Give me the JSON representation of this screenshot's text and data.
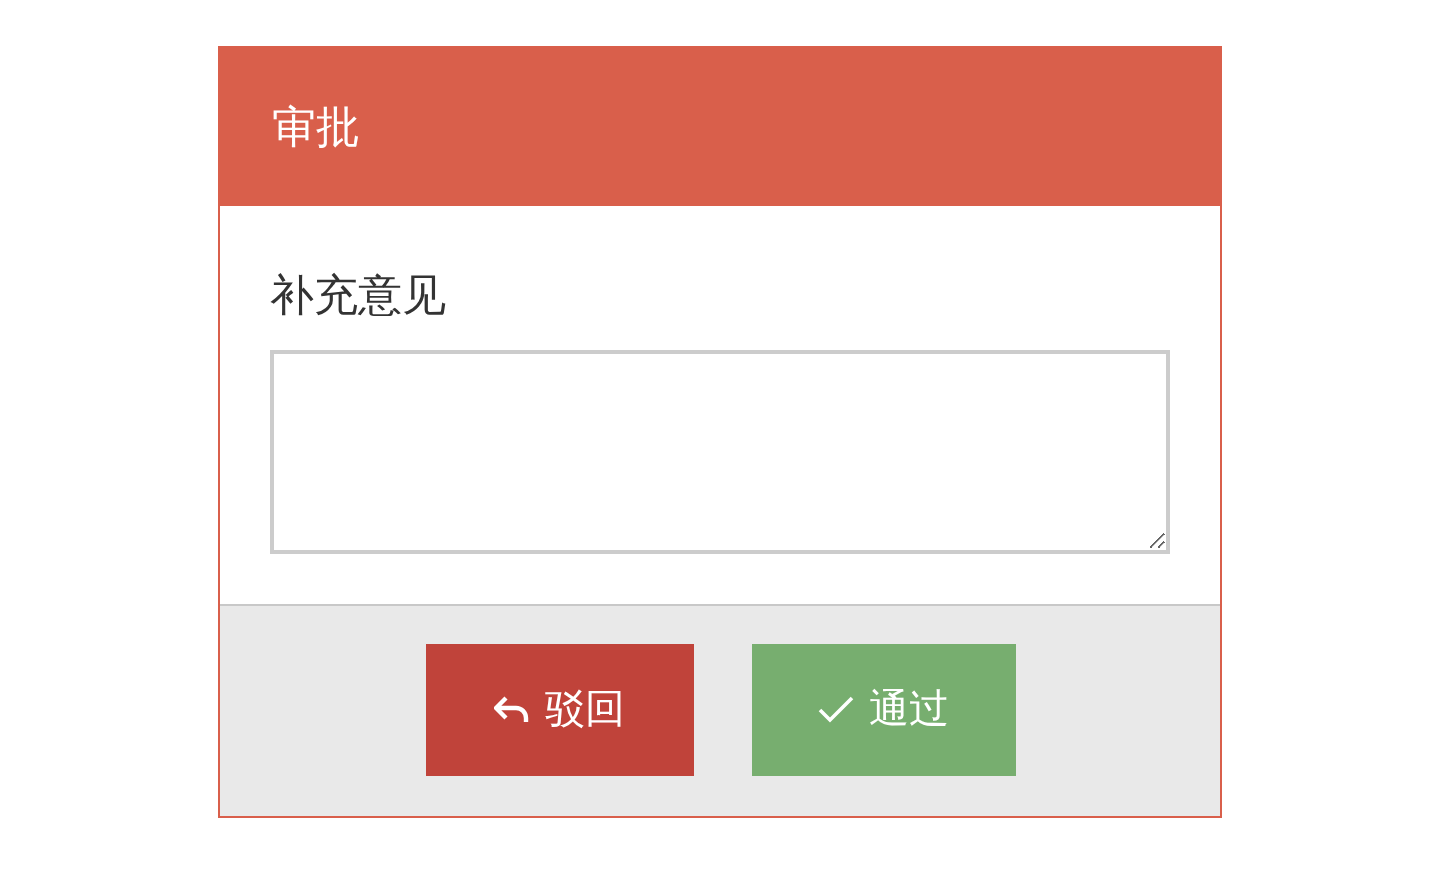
{
  "dialog": {
    "title": "审批",
    "field_label": "补充意见"
  },
  "buttons": [
    {
      "kind": "reject",
      "label": "驳回"
    },
    {
      "kind": "approve",
      "label": "通过"
    }
  ]
}
